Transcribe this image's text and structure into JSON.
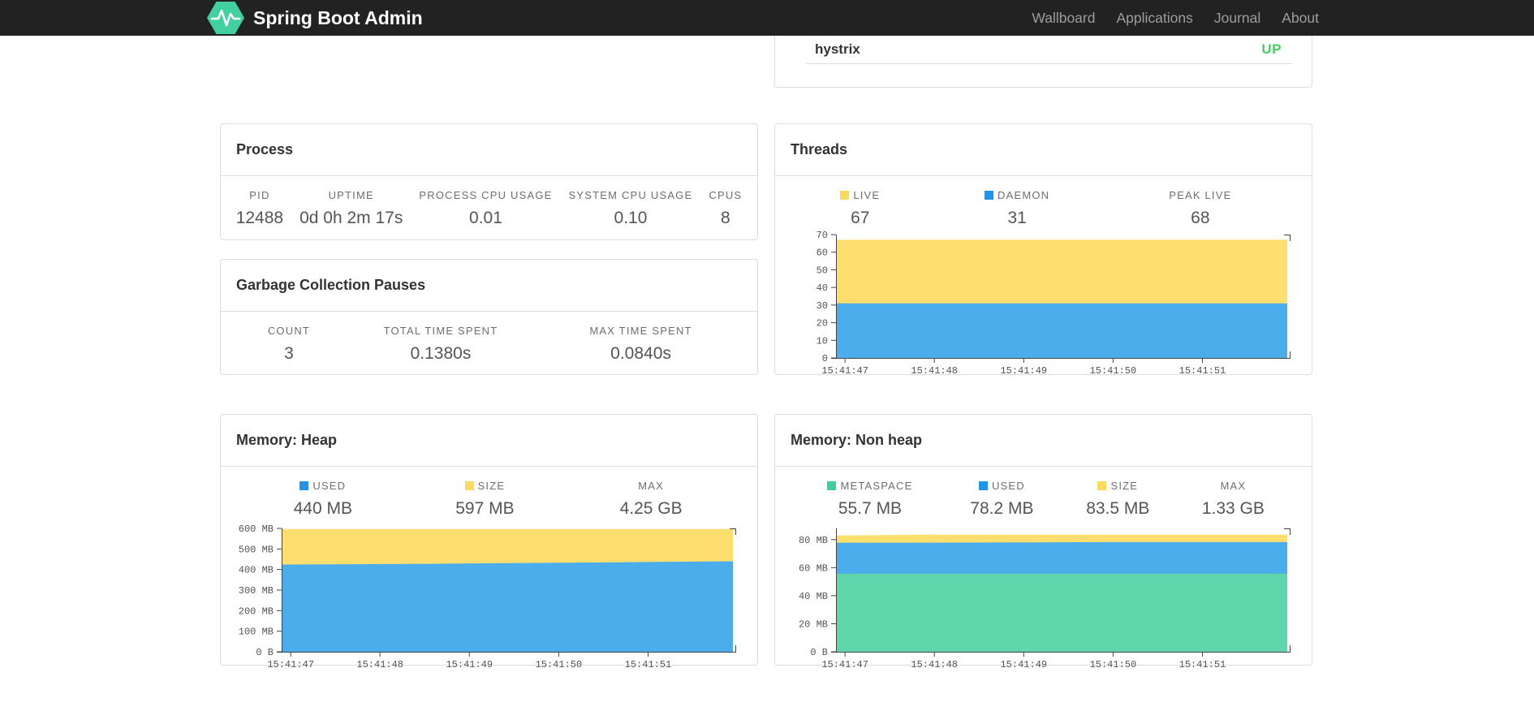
{
  "navbar": {
    "brand": "Spring Boot Admin",
    "links": [
      {
        "label": "Wallboard"
      },
      {
        "label": "Applications"
      },
      {
        "label": "Journal"
      },
      {
        "label": "About"
      }
    ]
  },
  "application": {
    "name": "hystrix",
    "status": "UP"
  },
  "colors": {
    "brand_green": "#41d0a0",
    "status_up": "#42d35f",
    "legend_yellow": "#fbdb5d",
    "legend_blue": "#1e95eb",
    "legend_green": "#3ecd9d",
    "area_yellow": "#fdde6e",
    "area_blue": "#4badec",
    "area_green": "#5fd6ac",
    "axis": "#444444"
  },
  "panels": {
    "process": {
      "title": "Process",
      "stats": [
        {
          "label": "PID",
          "value": "12488"
        },
        {
          "label": "UPTIME",
          "value": "0d 0h 2m 17s"
        },
        {
          "label": "PROCESS CPU USAGE",
          "value": "0.01"
        },
        {
          "label": "SYSTEM CPU USAGE",
          "value": "0.10"
        },
        {
          "label": "CPUS",
          "value": "8"
        }
      ]
    },
    "gc": {
      "title": "Garbage Collection Pauses",
      "stats": [
        {
          "label": "COUNT",
          "value": "3"
        },
        {
          "label": "TOTAL TIME SPENT",
          "value": "0.1380s"
        },
        {
          "label": "MAX TIME SPENT",
          "value": "0.0840s"
        }
      ]
    },
    "threads": {
      "title": "Threads",
      "stats": [
        {
          "label": "LIVE",
          "value": "67",
          "color": "#fbdb5d"
        },
        {
          "label": "DAEMON",
          "value": "31",
          "color": "#1e95eb"
        },
        {
          "label": "PEAK LIVE",
          "value": "68"
        }
      ]
    },
    "heap": {
      "title": "Memory: Heap",
      "stats": [
        {
          "label": "USED",
          "value": "440 MB",
          "color": "#1e95eb"
        },
        {
          "label": "SIZE",
          "value": "597 MB",
          "color": "#fbdb5d"
        },
        {
          "label": "MAX",
          "value": "4.25 GB"
        }
      ]
    },
    "nonheap": {
      "title": "Memory: Non heap",
      "stats": [
        {
          "label": "METASPACE",
          "value": "55.7 MB",
          "color": "#3ecd9d"
        },
        {
          "label": "USED",
          "value": "78.2 MB",
          "color": "#1e95eb"
        },
        {
          "label": "SIZE",
          "value": "83.5 MB",
          "color": "#fbdb5d"
        },
        {
          "label": "MAX",
          "value": "1.33 GB"
        }
      ]
    }
  },
  "chart_data": {
    "threads": {
      "type": "area",
      "stacked": true,
      "title": "Threads",
      "ylim": [
        0,
        70
      ],
      "ymax": 70,
      "x_labels": [
        "15:41:47",
        "15:41:48",
        "15:41:49",
        "15:41:50",
        "15:41:51"
      ],
      "y_ticks": [
        {
          "v": 70,
          "label": "70"
        },
        {
          "v": 60,
          "label": "60"
        },
        {
          "v": 50,
          "label": "50"
        },
        {
          "v": 40,
          "label": "40"
        },
        {
          "v": 30,
          "label": "30"
        },
        {
          "v": 20,
          "label": "20"
        },
        {
          "v": 10,
          "label": "10"
        },
        {
          "v": 0,
          "label": "0"
        }
      ],
      "series": [
        {
          "name": "LIVE",
          "color": "#fdde6e",
          "values": [
            67,
            67,
            67,
            67,
            67,
            67
          ]
        },
        {
          "name": "DAEMON",
          "color": "#4badec",
          "values": [
            31,
            31,
            31,
            31,
            31,
            31
          ]
        }
      ]
    },
    "heap": {
      "type": "area",
      "stacked": true,
      "title": "Memory: Heap",
      "ylim": [
        0,
        600
      ],
      "ymax": 600,
      "x_labels": [
        "15:41:47",
        "15:41:48",
        "15:41:49",
        "15:41:50",
        "15:41:51"
      ],
      "y_ticks": [
        {
          "v": 600,
          "label": "600 MB"
        },
        {
          "v": 500,
          "label": "500 MB"
        },
        {
          "v": 400,
          "label": "400 MB"
        },
        {
          "v": 300,
          "label": "300 MB"
        },
        {
          "v": 200,
          "label": "200 MB"
        },
        {
          "v": 100,
          "label": "100 MB"
        },
        {
          "v": 0,
          "label": "0 B"
        }
      ],
      "series": [
        {
          "name": "SIZE",
          "color": "#fdde6e",
          "values": [
            597,
            597,
            597,
            597,
            597,
            597,
            597
          ]
        },
        {
          "name": "USED",
          "color": "#4badec",
          "values": [
            424,
            426,
            428,
            431,
            434,
            437,
            440
          ]
        }
      ]
    },
    "nonheap": {
      "type": "area",
      "stacked": true,
      "title": "Memory: Non heap",
      "ylim": [
        0,
        88
      ],
      "ymax": 88,
      "x_labels": [
        "15:41:47",
        "15:41:48",
        "15:41:49",
        "15:41:50",
        "15:41:51"
      ],
      "y_ticks": [
        {
          "v": 80,
          "label": "80 MB"
        },
        {
          "v": 60,
          "label": "60 MB"
        },
        {
          "v": 40,
          "label": "40 MB"
        },
        {
          "v": 20,
          "label": "20 MB"
        },
        {
          "v": 0,
          "label": "0 B"
        }
      ],
      "series": [
        {
          "name": "SIZE",
          "color": "#fdde6e",
          "values": [
            82.9,
            83.5,
            83.5,
            83.5,
            83.5,
            83.5
          ]
        },
        {
          "name": "USED",
          "color": "#4badec",
          "values": [
            77.8,
            77.8,
            78.0,
            78.2,
            78.2,
            78.2
          ]
        },
        {
          "name": "METASPACE",
          "color": "#5fd6ac",
          "values": [
            55.7,
            55.7,
            55.7,
            55.7,
            55.7,
            55.7
          ]
        }
      ]
    }
  }
}
